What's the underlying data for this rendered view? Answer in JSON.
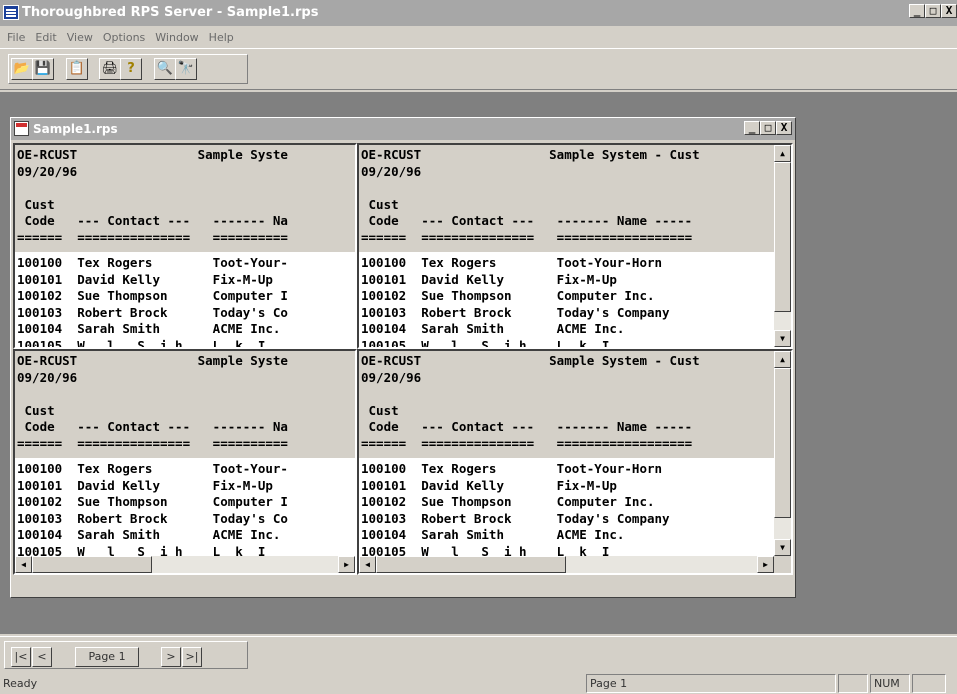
{
  "app": {
    "title": "Thoroughbred RPS Server - Sample1.rps",
    "window_controls": [
      "_",
      "□",
      "X"
    ]
  },
  "menu": [
    "File",
    "Edit",
    "View",
    "Options",
    "Window",
    "Help"
  ],
  "toolbar": {
    "buttons": [
      {
        "name": "open-icon",
        "glyph": "📂"
      },
      {
        "name": "save-icon",
        "glyph": "💾"
      },
      {
        "name": "copy-icon",
        "glyph": "📋"
      },
      {
        "name": "print-icon",
        "glyph": "🖨"
      },
      {
        "name": "help-icon",
        "glyph": "?"
      },
      {
        "name": "zoom-icon",
        "glyph": "🔍"
      },
      {
        "name": "find-icon",
        "glyph": "🔭"
      }
    ]
  },
  "child_window": {
    "title": "Sample1.rps",
    "controls": [
      "_",
      "□",
      "X"
    ]
  },
  "panes": {
    "left_text": "OE-RCUST                Sample Syste\n09/20/96\n\n Cust\n Code   --- Contact ---   ------- Na\n======  ===============   ==========",
    "left_rows": "100100  Tex Rogers        Toot-Your-\n100101  David Kelly       Fix-M-Up\n100102  Sue Thompson      Computer I\n100103  Robert Brock      Today's Co\n100104  Sarah Smith       ACME Inc.\n100105  W   l   S  i h    L  k  I",
    "right_text": "OE-RCUST                 Sample System - Cust\n09/20/96\n\n Cust\n Code   --- Contact ---   ------- Name -----\n======  ===============   ==================",
    "right_rows": "100100  Tex Rogers        Toot-Your-Horn\n100101  David Kelly       Fix-M-Up\n100102  Sue Thompson      Computer Inc.\n100103  Robert Brock      Today's Company\n100104  Sarah Smith       ACME Inc.\n100105  W   l   S  i h    L  k  I"
  },
  "navigation": {
    "first": "|<",
    "prev": "<",
    "page": "Page 1",
    "next": ">",
    "last": ">|"
  },
  "status": {
    "text": "Ready",
    "page": "Page 1",
    "num": "NUM"
  }
}
